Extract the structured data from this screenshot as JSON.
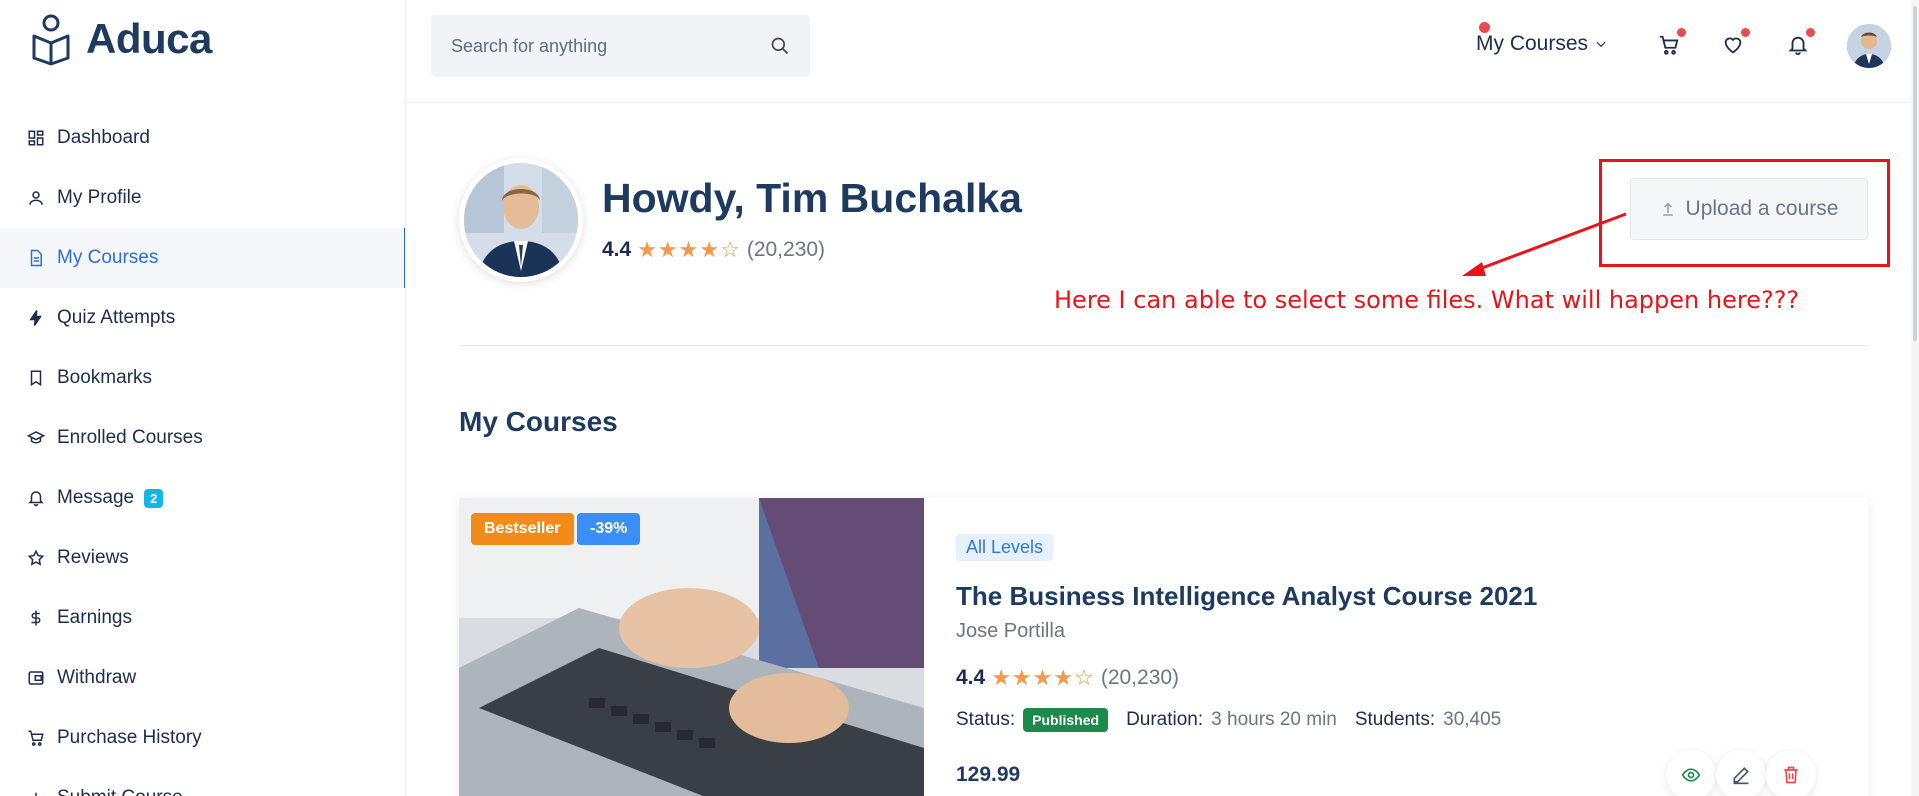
{
  "brand": {
    "name": "Aduca"
  },
  "search": {
    "placeholder": "Search for anything"
  },
  "header": {
    "my_courses_label": "My Courses"
  },
  "sidebar": {
    "items": [
      {
        "label": "Dashboard",
        "icon": "dashboard-icon"
      },
      {
        "label": "My Profile",
        "icon": "user-icon"
      },
      {
        "label": "My Courses",
        "icon": "file-icon",
        "active": true
      },
      {
        "label": "Quiz Attempts",
        "icon": "lightning-icon"
      },
      {
        "label": "Bookmarks",
        "icon": "bookmark-icon"
      },
      {
        "label": "Enrolled Courses",
        "icon": "graduation-cap-icon"
      },
      {
        "label": "Message",
        "icon": "bell-icon",
        "badge": "2"
      },
      {
        "label": "Reviews",
        "icon": "star-icon"
      },
      {
        "label": "Earnings",
        "icon": "dollar-icon"
      },
      {
        "label": "Withdraw",
        "icon": "wallet-icon"
      },
      {
        "label": "Purchase History",
        "icon": "cart-icon"
      },
      {
        "label": "Submit Course",
        "icon": "plus-icon"
      }
    ]
  },
  "profile": {
    "greeting": "Howdy, Tim Buchalka",
    "rating": "4.4",
    "rating_count": "(20,230)",
    "stars": "★★★★☆"
  },
  "upload": {
    "label": "Upload a course"
  },
  "annotation": {
    "text": "Here I can able to select some files. What will happen here???"
  },
  "section": {
    "title": "My Courses"
  },
  "course": {
    "badge_bestseller": "Bestseller",
    "badge_discount": "-39%",
    "level": "All Levels",
    "title": "The Business Intelligence Analyst Course 2021",
    "instructor": "Jose Portilla",
    "rating": "4.4",
    "rating_count": "(20,230)",
    "stars": "★★★★☆",
    "status_label": "Status:",
    "status": "Published",
    "duration_label": "Duration:",
    "duration": "3 hours 20 min",
    "students_label": "Students:",
    "students": "30,405",
    "price": "129.99"
  },
  "colors": {
    "accent": "#2c6fd4",
    "annotation": "#e8141a",
    "published": "#1b8a4b",
    "star": "#f2994a"
  }
}
